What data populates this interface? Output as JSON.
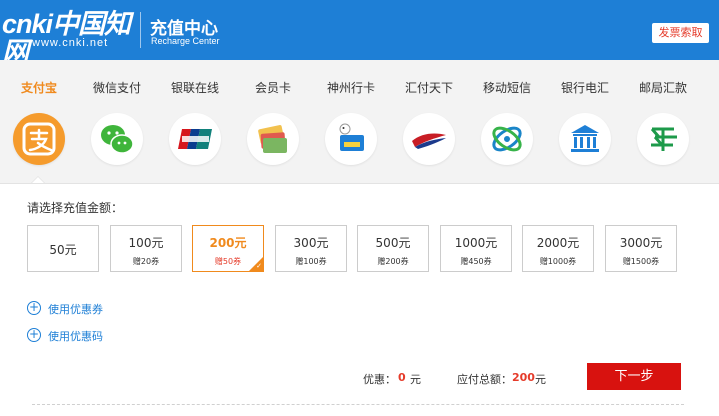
{
  "header": {
    "logo_text": "cnki中国知网",
    "logo_url": "www.cnki.net",
    "title_cn": "充值中心",
    "title_en": "Recharge Center",
    "invoice_button": "发票索取"
  },
  "payment_tabs": [
    {
      "label": "支付宝",
      "icon": "alipay-icon",
      "active": true
    },
    {
      "label": "微信支付",
      "icon": "wechat-icon",
      "active": false
    },
    {
      "label": "银联在线",
      "icon": "unionpay-icon",
      "active": false
    },
    {
      "label": "会员卡",
      "icon": "member-card-icon",
      "active": false
    },
    {
      "label": "神州行卡",
      "icon": "shenzhouxing-icon",
      "active": false
    },
    {
      "label": "汇付天下",
      "icon": "chinapnr-icon",
      "active": false
    },
    {
      "label": "移动短信",
      "icon": "china-mobile-icon",
      "active": false
    },
    {
      "label": "银行电汇",
      "icon": "bank-icon",
      "active": false
    },
    {
      "label": "邮局汇款",
      "icon": "post-office-icon",
      "active": false
    }
  ],
  "amounts": {
    "prompt": "请选择充值金额：",
    "options": [
      {
        "value": "50元",
        "coupon": ""
      },
      {
        "value": "100元",
        "coupon": "赠20券"
      },
      {
        "value": "200元",
        "coupon": "赠50券",
        "selected": true
      },
      {
        "value": "300元",
        "coupon": "赠100券"
      },
      {
        "value": "500元",
        "coupon": "赠200券"
      },
      {
        "value": "1000元",
        "coupon": "赠450券"
      },
      {
        "value": "2000元",
        "coupon": "赠1000券"
      },
      {
        "value": "3000元",
        "coupon": "赠1500券"
      }
    ]
  },
  "coupons": {
    "use_coupon": "使用优惠券",
    "use_code": "使用优惠码"
  },
  "summary": {
    "discount_label": "优惠：",
    "discount_value": "0",
    "discount_unit": "元",
    "total_label": "应付总额：",
    "total_value": "200",
    "total_unit": "元"
  },
  "next_button": "下一步",
  "colors": {
    "header_blue": "#1e7fd6",
    "accent_orange": "#f08a1d",
    "button_red": "#d8120f",
    "price_red": "#e53b2a"
  }
}
